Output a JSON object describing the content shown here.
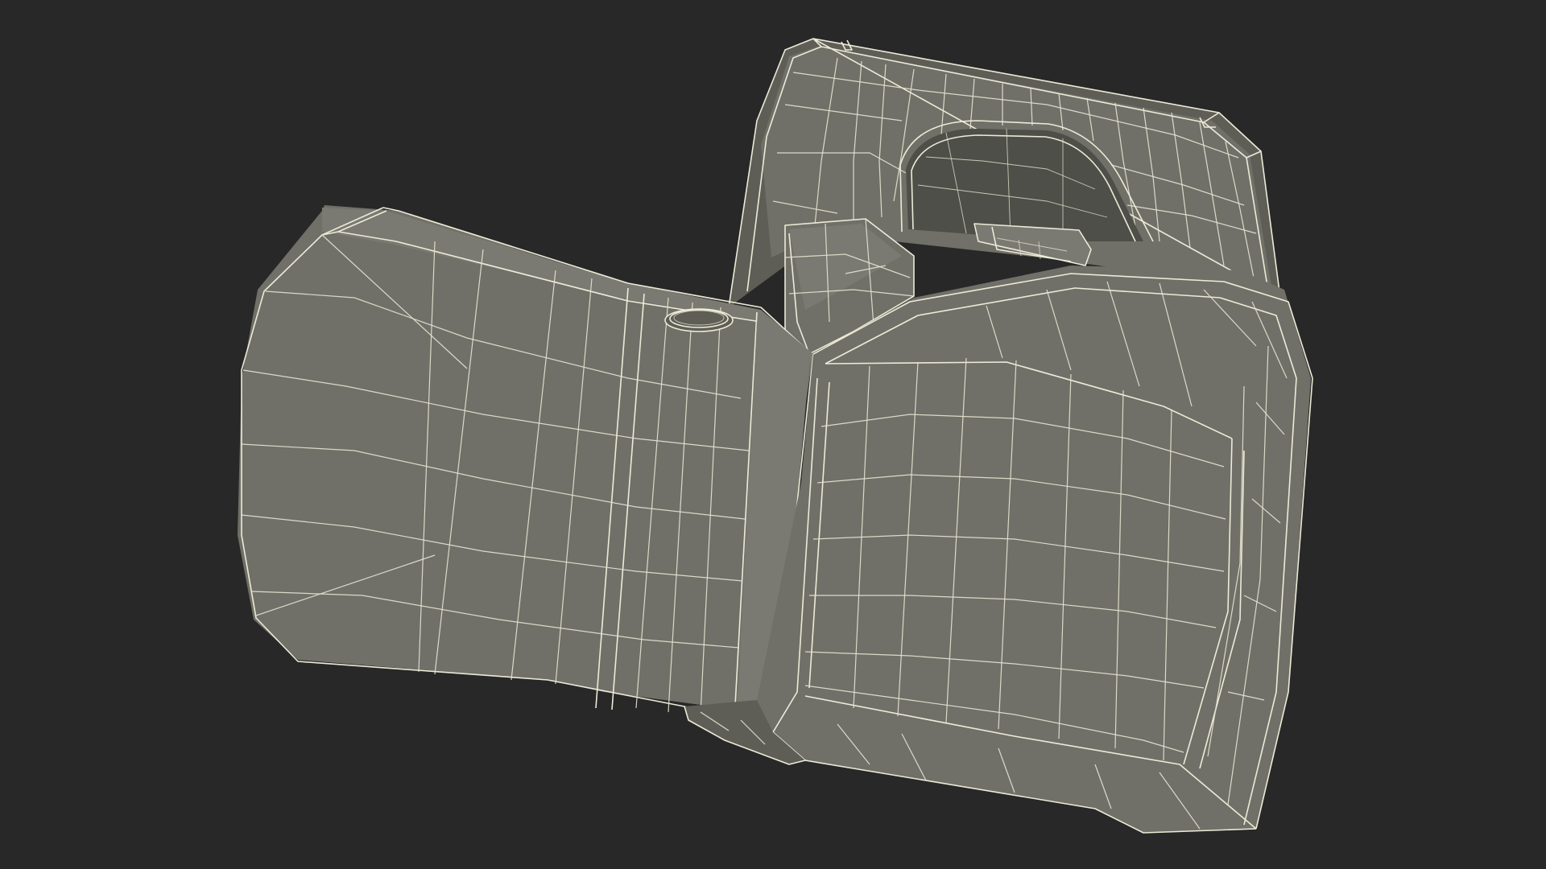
{
  "scene": {
    "background_color": "#282828",
    "mesh_fill_color": "#707068",
    "wire_color": "#ecebd8",
    "render_mode": "wireframe-over-shaded",
    "subject_icon": "camera-mesh-icon"
  }
}
